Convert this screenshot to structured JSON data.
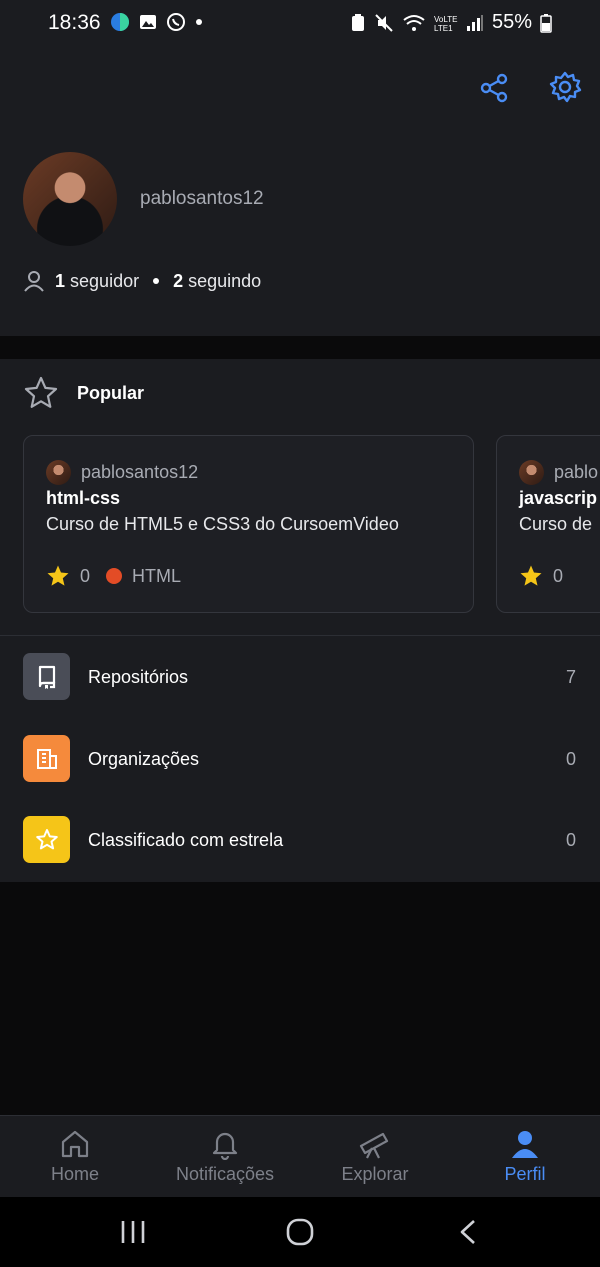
{
  "status_bar": {
    "time": "18:36",
    "battery": "55%",
    "network": "LTE1"
  },
  "profile": {
    "username": "pablosantos12",
    "followers_count": "1",
    "followers_label": "seguidor",
    "following_count": "2",
    "following_label": "seguindo"
  },
  "popular": {
    "title": "Popular",
    "cards": [
      {
        "owner": "pablosantos12",
        "name": "html-css",
        "description": "Curso de HTML5 e CSS3 do CursoemVideo",
        "stars": "0",
        "language": "HTML",
        "language_color": "#e34c26"
      },
      {
        "owner": "pablo",
        "name": "javascrip",
        "description": "Curso de",
        "stars": "0"
      }
    ]
  },
  "menu": [
    {
      "label": "Repositórios",
      "count": "7",
      "icon": "repo-icon",
      "color": "#4a4d57"
    },
    {
      "label": "Organizações",
      "count": "0",
      "icon": "organization-icon",
      "color": "#f58a3c"
    },
    {
      "label": "Classificado com estrela",
      "count": "0",
      "icon": "star-icon",
      "color": "#f5c518"
    }
  ],
  "bottom_nav": [
    {
      "label": "Home",
      "icon": "home-icon"
    },
    {
      "label": "Notificações",
      "icon": "bell-icon"
    },
    {
      "label": "Explorar",
      "icon": "telescope-icon"
    },
    {
      "label": "Perfil",
      "icon": "person-icon",
      "active": true
    }
  ],
  "colors": {
    "accent": "#4a8df5",
    "background": "#1b1c20",
    "page_background": "#0a0a0b"
  }
}
